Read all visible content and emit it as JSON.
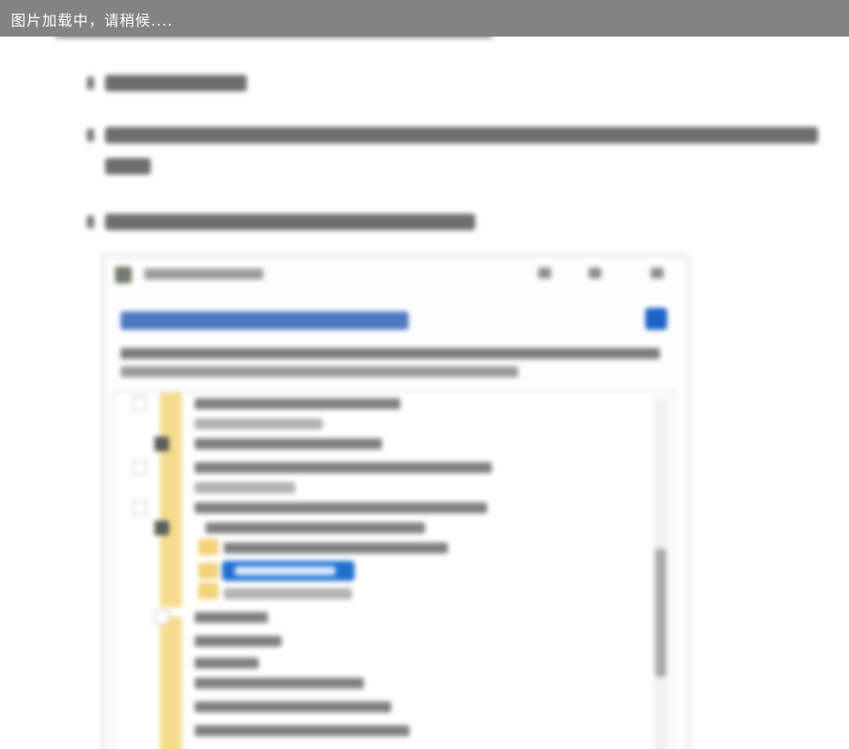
{
  "loading": {
    "text": "图片加载中，请稍候...."
  }
}
